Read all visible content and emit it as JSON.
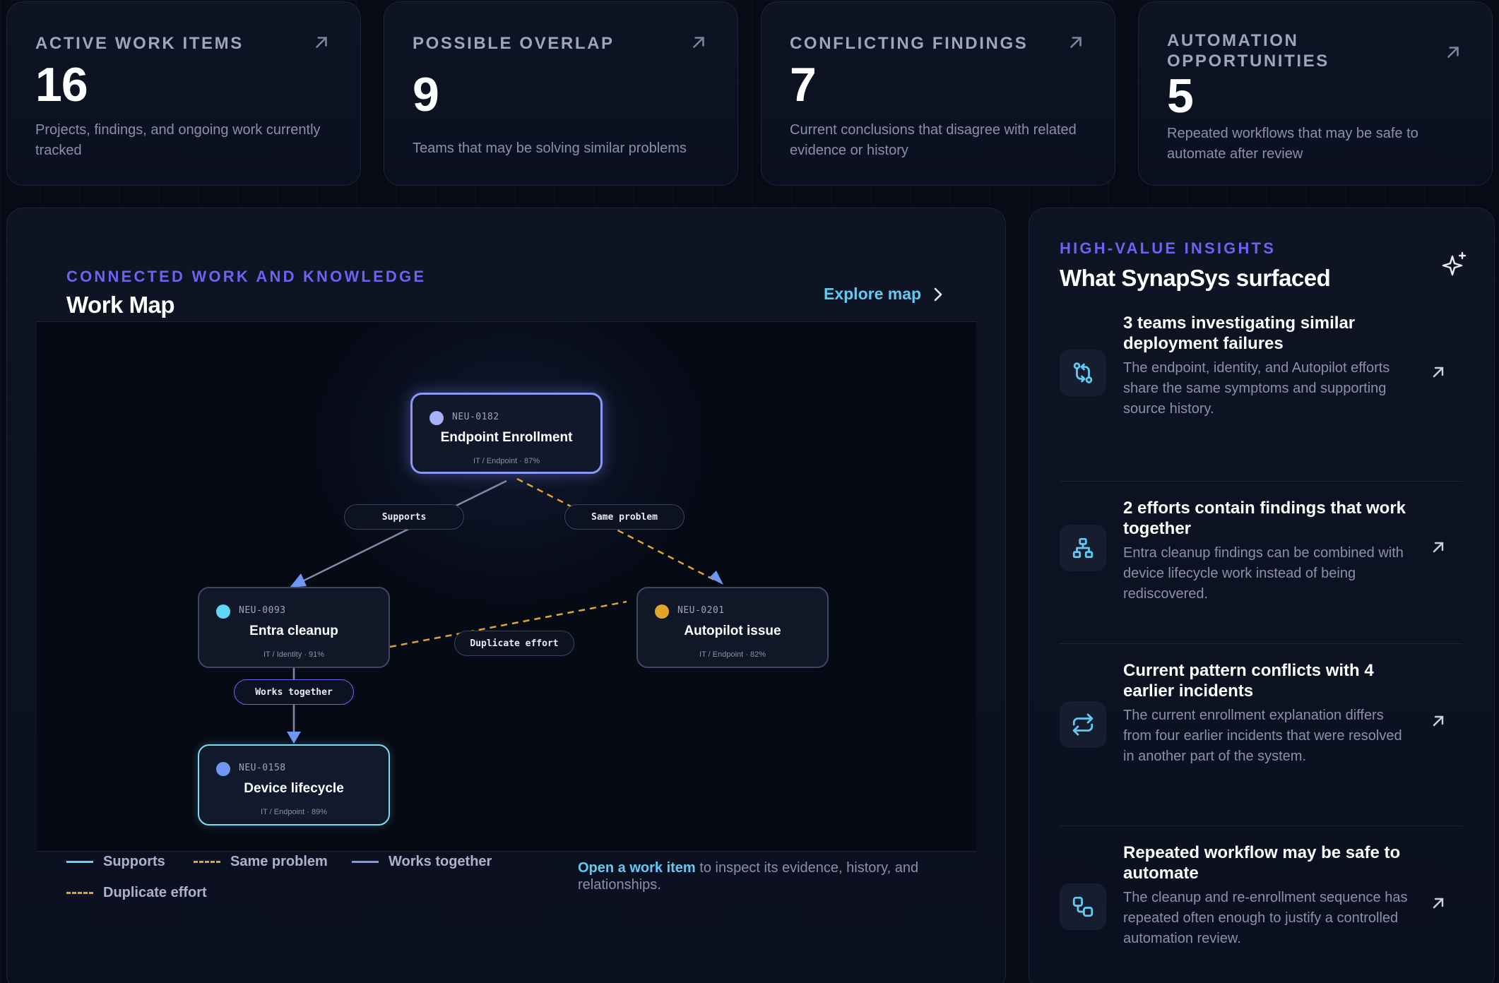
{
  "stats": [
    {
      "label": "Active work items",
      "value": "16",
      "desc": "Projects, findings, and ongoing work currently tracked",
      "icon": "arrow-up-right-icon"
    },
    {
      "label": "Possible overlap",
      "value": "9",
      "desc": "Teams that may be solving similar problems",
      "icon": "arrow-up-right-icon"
    },
    {
      "label": "Conflicting findings",
      "value": "7",
      "desc": "Current conclusions that disagree with related evidence or history",
      "icon": "arrow-up-right-icon"
    },
    {
      "label": "Automation opportunities",
      "value": "5",
      "desc": "Repeated workflows that may be safe to automate after review",
      "icon": "arrow-up-right-icon"
    }
  ],
  "map": {
    "eyebrow": "Connected work and knowledge",
    "title": "Work Map",
    "explore_label": "Explore map",
    "nodes": [
      {
        "id": "NEU-0182",
        "title": "Endpoint Enrollment",
        "meta": "IT / Endpoint · 87%",
        "dot_color": "#a9b0f5"
      },
      {
        "id": "NEU-0093",
        "title": "Entra cleanup",
        "meta": "IT / Identity · 91%",
        "dot_color": "#5fd6f3"
      },
      {
        "id": "NEU-0201",
        "title": "Autopilot issue",
        "meta": "IT / Endpoint · 82%",
        "dot_color": "#e0a62a"
      },
      {
        "id": "NEU-0158",
        "title": "Device lifecycle",
        "meta": "IT / Endpoint · 89%",
        "dot_color": "#6f97f2"
      }
    ],
    "edge_labels": {
      "supports": "Supports",
      "same_problem": "Same problem",
      "duplicate_effort": "Duplicate effort",
      "works_together": "Works together"
    },
    "legend": [
      {
        "label": "Supports",
        "color": "#5fd6f3",
        "style": "solid"
      },
      {
        "label": "Same problem",
        "color": "#e0a62a",
        "style": "dashed"
      },
      {
        "label": "Works together",
        "color": "#7f95f2",
        "style": "solid"
      },
      {
        "label": "Duplicate effort",
        "color": "#e0a62a",
        "style": "dashed"
      }
    ],
    "hint_link": "Open a work item",
    "hint_text": " to inspect its evidence, history, and relationships."
  },
  "insights": {
    "eyebrow": "High-value insights",
    "title": "What SynapSys surfaced",
    "items": [
      {
        "title": "3 teams investigating similar deployment failures",
        "body": "The endpoint, identity, and Autopilot efforts share the same symptoms and supporting source history.",
        "icon": "git-compare-icon"
      },
      {
        "title": "2 efforts contain findings that work together",
        "body": "Entra cleanup findings can be combined with device lifecycle work instead of being rediscovered.",
        "icon": "hierarchy-icon"
      },
      {
        "title": "Current pattern conflicts with 4 earlier incidents",
        "body": "The current enrollment explanation differs from four earlier incidents that were resolved in another part of the system.",
        "icon": "repeat-icon"
      },
      {
        "title": "Repeated workflow may be safe to automate",
        "body": "The cleanup and re-enrollment sequence has repeated often enough to justify a controlled automation review.",
        "icon": "workflow-icon"
      }
    ]
  }
}
